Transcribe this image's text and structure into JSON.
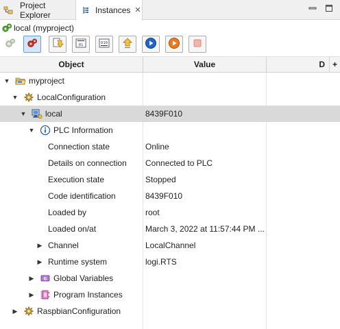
{
  "tabs": [
    {
      "label": "Project Explorer",
      "icon": "project-explorer-icon"
    },
    {
      "label": "Instances",
      "icon": "instances-icon",
      "active": true
    }
  ],
  "view_title": "local (myproject)",
  "toolbar": {
    "buttons": [
      {
        "name": "refresh-instances-button",
        "icon": "gears-disabled-icon",
        "enabled": false
      },
      {
        "name": "connect-button",
        "icon": "gears-red-icon",
        "pressed": true
      },
      {
        "name": "download-button",
        "icon": "download-arrow-icon"
      },
      {
        "name": "binary-upload-button",
        "icon": "binary-icon"
      },
      {
        "name": "binary-download-button",
        "icon": "binary-icon"
      },
      {
        "name": "upload-button",
        "icon": "upload-arrow-icon"
      },
      {
        "name": "run-button",
        "icon": "play-blue-icon"
      },
      {
        "name": "run-orange-button",
        "icon": "play-orange-icon"
      },
      {
        "name": "stop-button",
        "icon": "stop-icon",
        "enabled": false
      }
    ]
  },
  "columns": {
    "object": "Object",
    "value": "Value",
    "d": "D",
    "plus": "+"
  },
  "tree": [
    {
      "label": "myproject",
      "value": "",
      "icon": "folder-icon",
      "expanded": true
    },
    {
      "label": "LocalConfiguration",
      "value": "",
      "icon": "configuration-gear-icon",
      "expanded": true
    },
    {
      "label": "local",
      "value": "8439F010",
      "icon": "resource-computer-icon",
      "expanded": true,
      "selected": true
    },
    {
      "label": "PLC Information",
      "value": "",
      "icon": "info-icon",
      "expanded": true
    },
    {
      "label": "Connection state",
      "value": "Online"
    },
    {
      "label": "Details on connection",
      "value": "Connected to PLC"
    },
    {
      "label": "Execution state",
      "value": "Stopped"
    },
    {
      "label": "Code identification",
      "value": "8439F010"
    },
    {
      "label": "Loaded by",
      "value": "root"
    },
    {
      "label": "Loaded on/at",
      "value": "March 3, 2022 at 11:57:44 PM ..."
    },
    {
      "label": "Channel",
      "value": "LocalChannel",
      "expanded": false
    },
    {
      "label": "Runtime system",
      "value": "logi.RTS",
      "expanded": false
    },
    {
      "label": "Global Variables",
      "value": "",
      "icon": "global-variables-icon",
      "expanded": false
    },
    {
      "label": "Program Instances",
      "value": "",
      "icon": "program-instances-icon",
      "expanded": false
    },
    {
      "label": "RaspbianConfiguration",
      "value": "",
      "icon": "configuration-gear-icon",
      "expanded": false
    }
  ]
}
